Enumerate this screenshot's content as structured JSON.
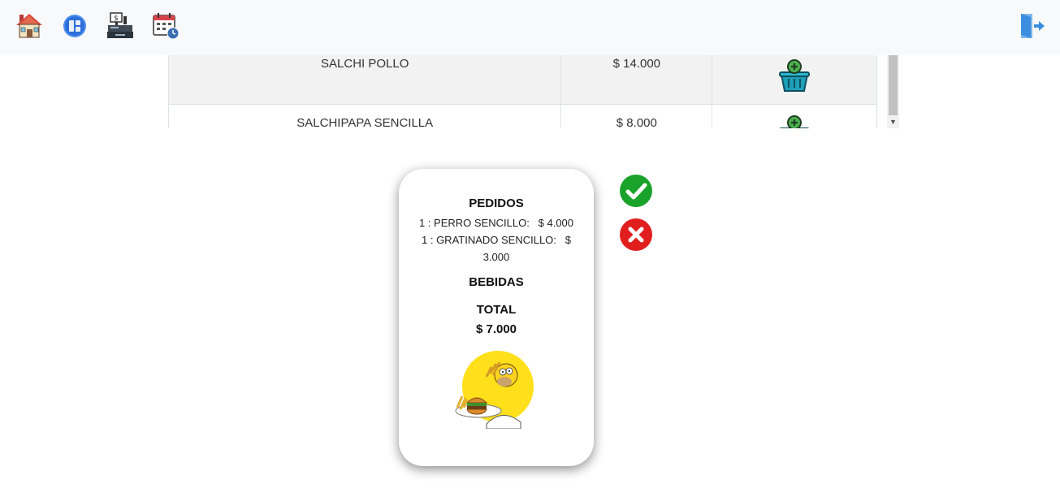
{
  "nav": {
    "icons": [
      "house-icon",
      "dashboard-app-icon",
      "cash-register-icon",
      "calendar-clock-icon"
    ],
    "logout_icon": "logout-door-icon"
  },
  "products": {
    "rows": [
      {
        "name": "SALCHI POLLO",
        "price": "$ 14.000",
        "action_icon": "add-to-basket-icon"
      },
      {
        "name": "SALCHIPAPA SENCILLA",
        "price": "$ 8.000",
        "action_icon": "add-to-basket-icon"
      }
    ]
  },
  "order": {
    "pedidos_title": "PEDIDOS",
    "items": [
      "1 : PERRO SENCILLO:   $ 4.000",
      "1 : GRATINADO SENCILLO:   $ 3.000"
    ],
    "bebidas_title": "BEBIDAS",
    "total_title": "TOTAL",
    "total_value": "$ 7.000"
  },
  "actions": {
    "confirm_icon": "check-circle-icon",
    "cancel_icon": "x-circle-icon"
  },
  "colors": {
    "topbar_bg": "#f8f9fa",
    "confirm_green": "#1aa32a",
    "cancel_red": "#e01e1e",
    "row_shaded": "#f2f2f2"
  }
}
